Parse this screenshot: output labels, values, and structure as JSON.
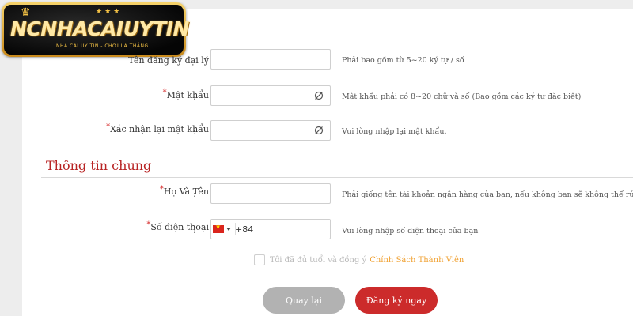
{
  "brand": {
    "logo_text": "NCNHACAIUYTIN",
    "tagline": "NHÀ CÁI UY TÍN - CHƠI LÀ THẮNG",
    "gold": "#f4c245",
    "accent_red": "#cc2b2b"
  },
  "form": {
    "rows": [
      {
        "label": "Tên đăng ký đại lý",
        "required": false,
        "value": "",
        "hint": "Phải bao gồm từ 5~20 ký tự / số",
        "icon": ""
      },
      {
        "label": "Mật khẩu",
        "required": true,
        "value": "",
        "hint": "Mật khẩu phải có 8~20 chữ và số (Bao gồm các ký tự đặc biệt)",
        "icon": "eye-off-icon"
      },
      {
        "label": "Xác nhận lại mật khẩu",
        "required": true,
        "value": "",
        "hint": "Vui lòng nhập lại mật khẩu.",
        "icon": "eye-off-icon"
      }
    ],
    "colon": ":"
  },
  "general": {
    "section_title": "Thông tin chung",
    "rows": [
      {
        "label": "Họ Và Tên",
        "required": true,
        "value": "",
        "hint": "Phải giống tên tài khoản ngân hàng của bạn, nếu không bạn sẽ không thể rút tiền"
      },
      {
        "label": "Số điện thoại",
        "required": true,
        "value": "+84",
        "hint": "Vui lòng nhập số điện thoại của bạn",
        "flag": "vietnam-flag-icon"
      }
    ]
  },
  "agreement": {
    "text": "Tôi đã đủ tuổi và đồng ý",
    "link": "Chính Sách Thành Viên",
    "checked": false
  },
  "buttons": {
    "back": "Quay lại",
    "register": "Đăng ký ngay"
  }
}
